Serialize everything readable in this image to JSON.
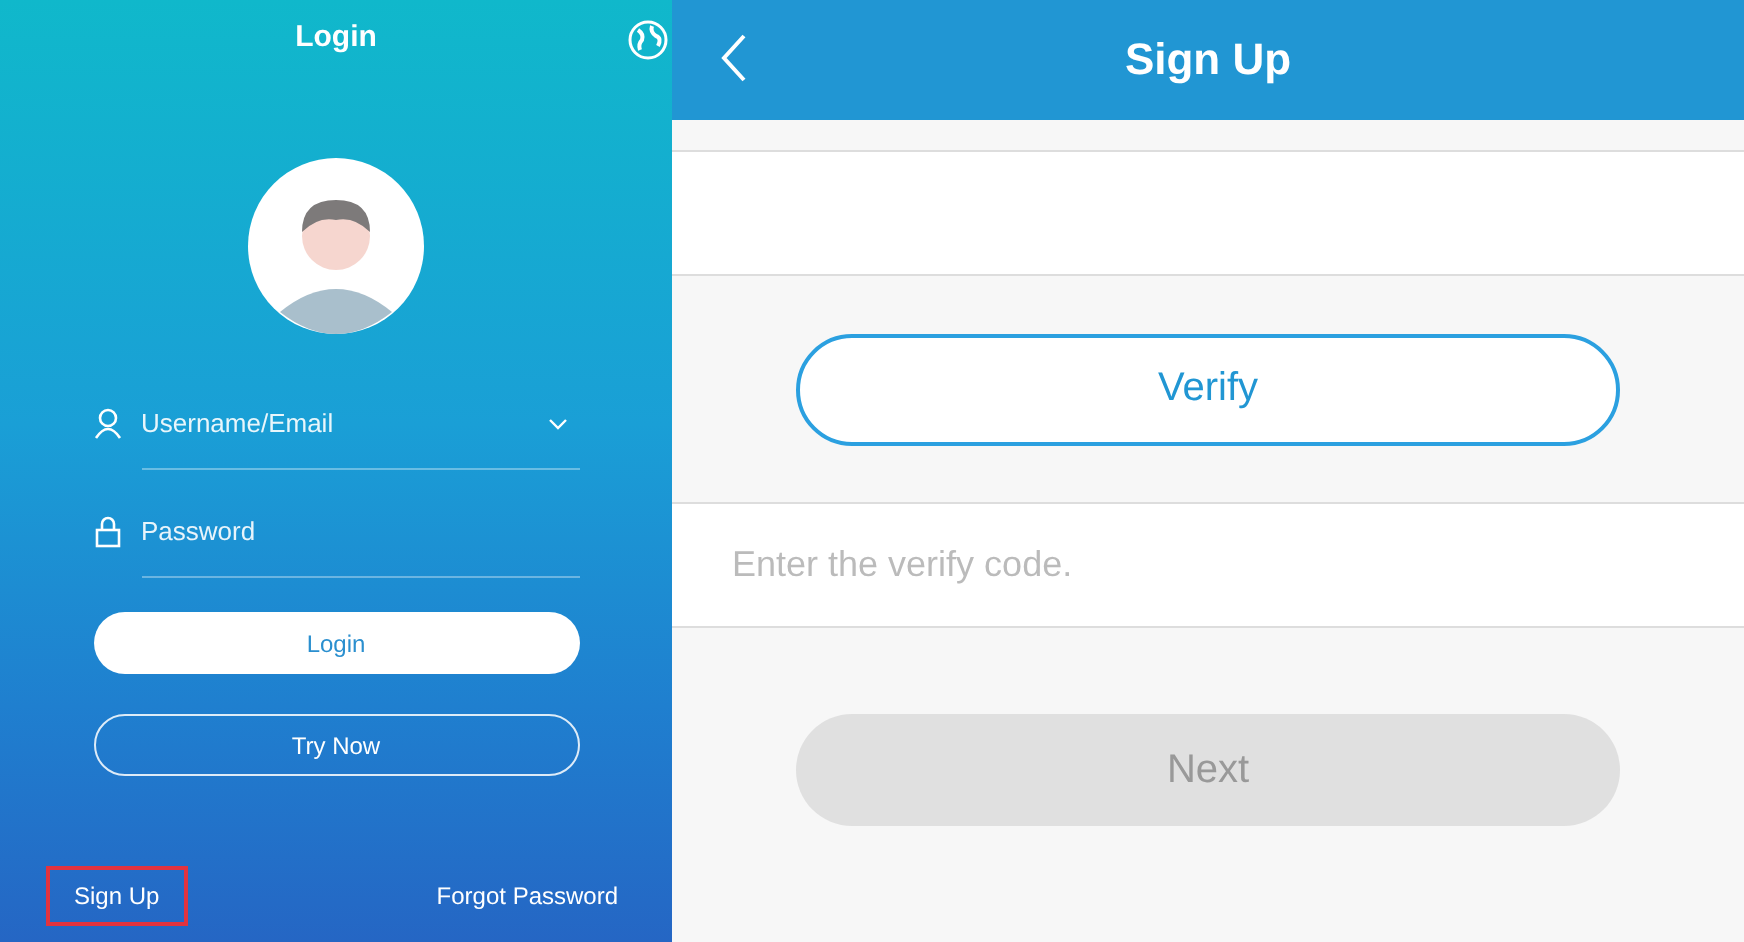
{
  "login_screen": {
    "title": "Login",
    "username_field": {
      "placeholder": "Username/Email"
    },
    "password_field": {
      "placeholder": "Password"
    },
    "buttons": [
      {
        "label": "Login",
        "kind": "filled"
      },
      {
        "label": "Try Now",
        "kind": "outline"
      }
    ],
    "links": [
      {
        "label": "Sign Up",
        "highlighted": true
      },
      {
        "label": "Forgot Password",
        "highlighted": false
      }
    ]
  },
  "signup_screen": {
    "title": "Sign Up",
    "verify_button": {
      "label": "Verify"
    },
    "code_field": {
      "placeholder": "Enter the verify code."
    },
    "next_button": {
      "label": "Next",
      "disabled": true
    }
  }
}
